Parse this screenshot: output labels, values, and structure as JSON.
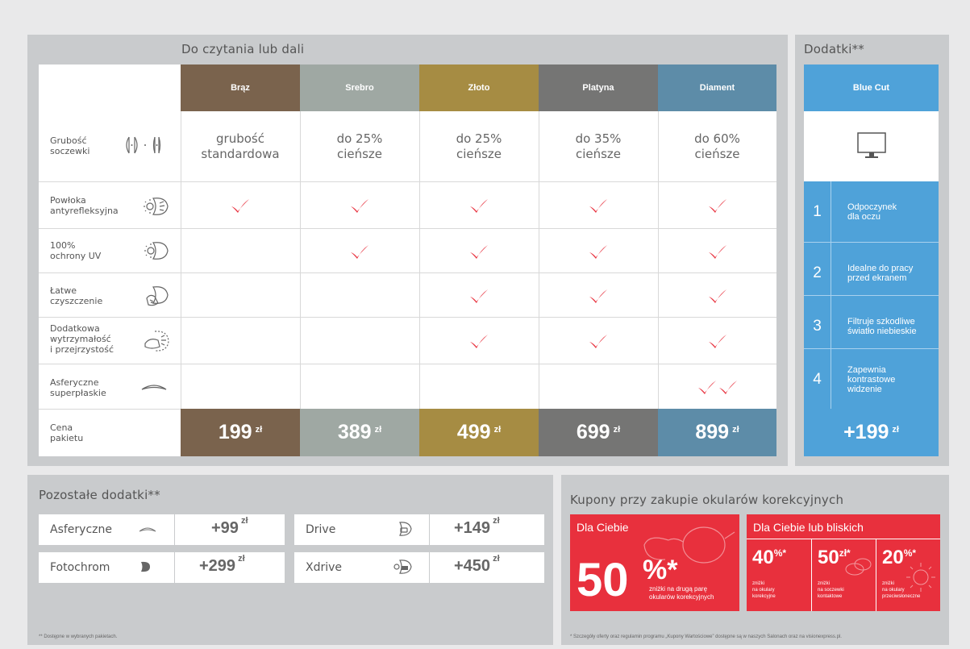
{
  "main": {
    "title": "Do czytania lub dali",
    "packages": [
      {
        "name": "Brąz",
        "color": "#7a634d",
        "thickness": [
          "grubość",
          "standardowa"
        ],
        "price": "199",
        "currency": "zł"
      },
      {
        "name": "Srebro",
        "color": "#9fa8a3",
        "thickness": [
          "do 25%",
          "cieńsze"
        ],
        "price": "389",
        "currency": "zł"
      },
      {
        "name": "Złoto",
        "color": "#a68c43",
        "thickness": [
          "do 25%",
          "cieńsze"
        ],
        "price": "499",
        "currency": "zł"
      },
      {
        "name": "Platyna",
        "color": "#757574",
        "thickness": [
          "do 35%",
          "cieńsze"
        ],
        "price": "699",
        "currency": "zł"
      },
      {
        "name": "Diament",
        "color": "#5d8ca8",
        "thickness": [
          "do 60%",
          "cieńsze"
        ],
        "price": "899",
        "currency": "zł"
      }
    ],
    "rows": [
      {
        "label": [
          "Grubość",
          "soczewki"
        ],
        "icon": "lens-thickness-icon"
      },
      {
        "label": [
          "Powłoka",
          "antyrefleksyjna"
        ],
        "icon": "anti-reflective-icon",
        "checks": [
          1,
          1,
          1,
          1,
          1
        ]
      },
      {
        "label": [
          "100%",
          "ochrony UV"
        ],
        "icon": "uv-protection-icon",
        "checks": [
          0,
          1,
          1,
          1,
          1
        ]
      },
      {
        "label": [
          "Łatwe",
          "czyszczenie"
        ],
        "icon": "easy-cleaning-icon",
        "checks": [
          0,
          0,
          1,
          1,
          1
        ]
      },
      {
        "label": [
          "Dodatkowa",
          "wytrzymałość",
          "i przejrzystość"
        ],
        "icon": "durability-icon",
        "checks": [
          0,
          0,
          1,
          1,
          1
        ]
      },
      {
        "label": [
          "Asferyczne",
          "superpłaskie"
        ],
        "icon": "aspheric-lens-icon",
        "checks": [
          0,
          0,
          0,
          0,
          2
        ]
      },
      {
        "label": [
          "Cena",
          "pakietu"
        ]
      }
    ]
  },
  "addons": {
    "title": "Dodatki**",
    "blue_cut": {
      "name": "Blue Cut",
      "icon": "monitor-icon",
      "color": "#4fa2d9",
      "features": [
        {
          "num": "1",
          "text": [
            "Odpoczynek",
            "dla oczu"
          ]
        },
        {
          "num": "2",
          "text": [
            "Idealne do pracy",
            "przed ekranem"
          ]
        },
        {
          "num": "3",
          "text": [
            "Filtruje szkodliwe",
            "światło niebieskie"
          ]
        },
        {
          "num": "4",
          "text": [
            "Zapewnia",
            "kontrastowe",
            "widzenie"
          ]
        }
      ],
      "price": "+199",
      "currency": "zł"
    }
  },
  "other": {
    "title": "Pozostałe dodatki**",
    "items": [
      {
        "name": "Asferyczne",
        "icon": "aspheric-lens-icon",
        "price": "+99",
        "currency": "zł"
      },
      {
        "name": "Fotochrom",
        "icon": "photochromic-icon",
        "price": "+299",
        "currency": "zł"
      },
      {
        "name": "Drive",
        "icon": "car-icon",
        "price": "+149",
        "currency": "zł"
      },
      {
        "name": "Xdrive",
        "icon": "car-sun-icon",
        "price": "+450",
        "currency": "zł"
      }
    ],
    "footnote": "** Dostępne w wybranych pakietach."
  },
  "coupons": {
    "title": "Kupony przy zakupie okularów korekcyjnych",
    "accent": "#e8303d",
    "c1": {
      "heading": "Dla Ciebie",
      "value": "50",
      "unit": "%",
      "star": "*",
      "desc": [
        "zniżki na drugą parę",
        "okularów korekcyjnych"
      ]
    },
    "c2": {
      "heading": "Dla Ciebie lub bliskich",
      "items": [
        {
          "value": "40",
          "unit": "%*",
          "desc": [
            "zniżki",
            "na okulary",
            "korekcyjne"
          ]
        },
        {
          "value": "50",
          "unit": "zł*",
          "desc": [
            "zniżki",
            "na soczewki",
            "kontaktowe"
          ]
        },
        {
          "value": "20",
          "unit": "%*",
          "desc": [
            "zniżki",
            "na okulary",
            "przeciwsłoneczne"
          ]
        }
      ]
    },
    "footnote": "* Szczegóły oferty oraz regulamin programu „Kupony Wartościowe” dostępne są w naszych Salonach oraz na visionexpress.pl."
  }
}
